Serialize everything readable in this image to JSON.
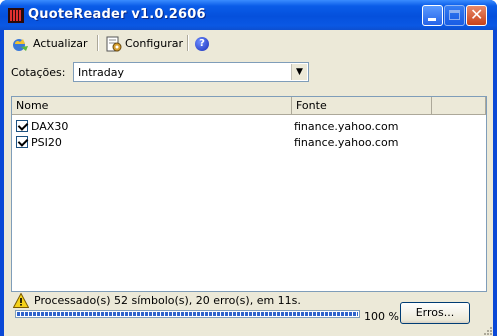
{
  "window": {
    "title": "QuoteReader v1.0.2606",
    "title_color": "#ffffff",
    "frame_color": "#0a48d6"
  },
  "toolbar": {
    "actualizar_label": "Actualizar",
    "configurar_label": "Configurar",
    "help_glyph": "?"
  },
  "quotes": {
    "label": "Cotações:",
    "selected": "Intraday"
  },
  "grid": {
    "columns": [
      "Nome",
      "Fonte",
      ""
    ],
    "rows": [
      {
        "checked": true,
        "name": "DAX30",
        "source": "finance.yahoo.com"
      },
      {
        "checked": true,
        "name": "PSI20",
        "source": "finance.yahoo.com"
      }
    ]
  },
  "status": {
    "message": "Processado(s) 52 símbolo(s), 20 erro(s), em 11s.",
    "progress_percent": 100,
    "progress_label": "100 %",
    "errors_button": "Erros...",
    "warning_icon": "warning-icon",
    "progress_color": "#2f63cc"
  }
}
